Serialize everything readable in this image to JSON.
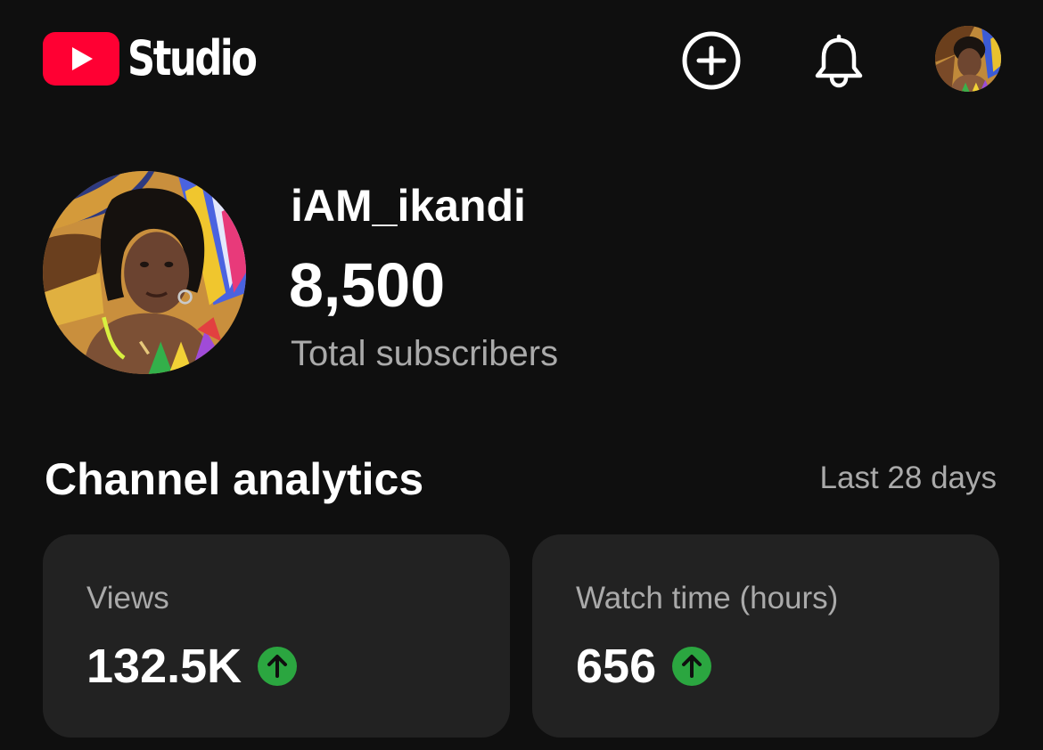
{
  "header": {
    "logo_text": "Studio",
    "brand_color": "#ff0033",
    "icons": [
      "youtube-logo-icon",
      "create-plus-icon",
      "notifications-bell-icon",
      "account-avatar"
    ]
  },
  "channel": {
    "name": "iAM_ikandi",
    "subscriber_count": "8,500",
    "subscriber_label": "Total subscribers"
  },
  "analytics": {
    "title": "Channel analytics",
    "period": "Last 28 days",
    "trend_color": "#2ba640",
    "cards": [
      {
        "label": "Views",
        "value": "132.5K",
        "trend": "up"
      },
      {
        "label": "Watch time (hours)",
        "value": "656",
        "trend": "up"
      }
    ]
  }
}
